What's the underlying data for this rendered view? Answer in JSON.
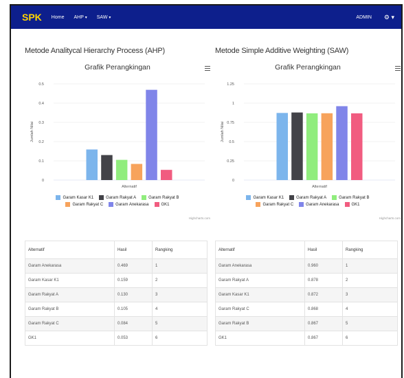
{
  "navbar": {
    "brand": "SPK",
    "links": [
      "Home",
      "AHP",
      "SAW"
    ],
    "user": "ADMIN"
  },
  "ahp": {
    "section_title": "Metode Analitycal Hierarchy Process (AHP)",
    "credit": "Highcharts.com",
    "table": {
      "headers": [
        "Alternatif",
        "Hasil",
        "Rangking"
      ],
      "rows": [
        [
          "Garam Anekarasa",
          "0.469",
          "1"
        ],
        [
          "Garam Kasar K1",
          "0.159",
          "2"
        ],
        [
          "Garam Rakyat A",
          "0.130",
          "3"
        ],
        [
          "Garam Rakyat B",
          "0.105",
          "4"
        ],
        [
          "Garam Rakyat C",
          "0.084",
          "5"
        ],
        [
          "GK1",
          "0.053",
          "6"
        ]
      ]
    }
  },
  "saw": {
    "section_title": "Metode Simple Additive Weighting (SAW)",
    "credit": "Highcharts.com",
    "table": {
      "headers": [
        "Alternatif",
        "Hasil",
        "Rangking"
      ],
      "rows": [
        [
          "Garam Anekarasa",
          "0.960",
          "1"
        ],
        [
          "Garam Rakyat A",
          "0.878",
          "2"
        ],
        [
          "Garam Kasar K1",
          "0.872",
          "3"
        ],
        [
          "Garam Rakyat C",
          "0.868",
          "4"
        ],
        [
          "Garam Rakyat B",
          "0.867",
          "5"
        ],
        [
          "GK1",
          "0.867",
          "6"
        ]
      ]
    }
  },
  "chart_data": [
    {
      "type": "bar",
      "title": "Grafik Perangkingan",
      "xlabel": "Alternatif",
      "ylabel": "Jumlah Nilai",
      "ylim": [
        0,
        0.5
      ],
      "yticks": [
        "0",
        "0.1",
        "0.2",
        "0.3",
        "0.4",
        "0.5"
      ],
      "legend_position": "bottom",
      "series": [
        {
          "name": "Garam Kasar K1",
          "value": 0.159,
          "color": "#7cb5ec"
        },
        {
          "name": "Garam Rakyat A",
          "value": 0.13,
          "color": "#434348"
        },
        {
          "name": "Garam Rakyat B",
          "value": 0.105,
          "color": "#90ed7d"
        },
        {
          "name": "Garam Rakyat C",
          "value": 0.084,
          "color": "#f7a35c"
        },
        {
          "name": "Garam Anekarasa",
          "value": 0.469,
          "color": "#8085e9"
        },
        {
          "name": "GK1",
          "value": 0.053,
          "color": "#f15c80"
        }
      ]
    },
    {
      "type": "bar",
      "title": "Grafik Perangkingan",
      "xlabel": "Alternatif",
      "ylabel": "Jumlah Nilai",
      "ylim": [
        0,
        1.25
      ],
      "yticks": [
        "0",
        "0.25",
        "0.5",
        "0.75",
        "1",
        "1.25"
      ],
      "legend_position": "bottom",
      "series": [
        {
          "name": "Garam Kasar K1",
          "value": 0.872,
          "color": "#7cb5ec"
        },
        {
          "name": "Garam Rakyat A",
          "value": 0.878,
          "color": "#434348"
        },
        {
          "name": "Garam Rakyat B",
          "value": 0.867,
          "color": "#90ed7d"
        },
        {
          "name": "Garam Rakyat C",
          "value": 0.868,
          "color": "#f7a35c"
        },
        {
          "name": "Garam Anekarasa",
          "value": 0.96,
          "color": "#8085e9"
        },
        {
          "name": "GK1",
          "value": 0.867,
          "color": "#f15c80"
        }
      ]
    }
  ]
}
